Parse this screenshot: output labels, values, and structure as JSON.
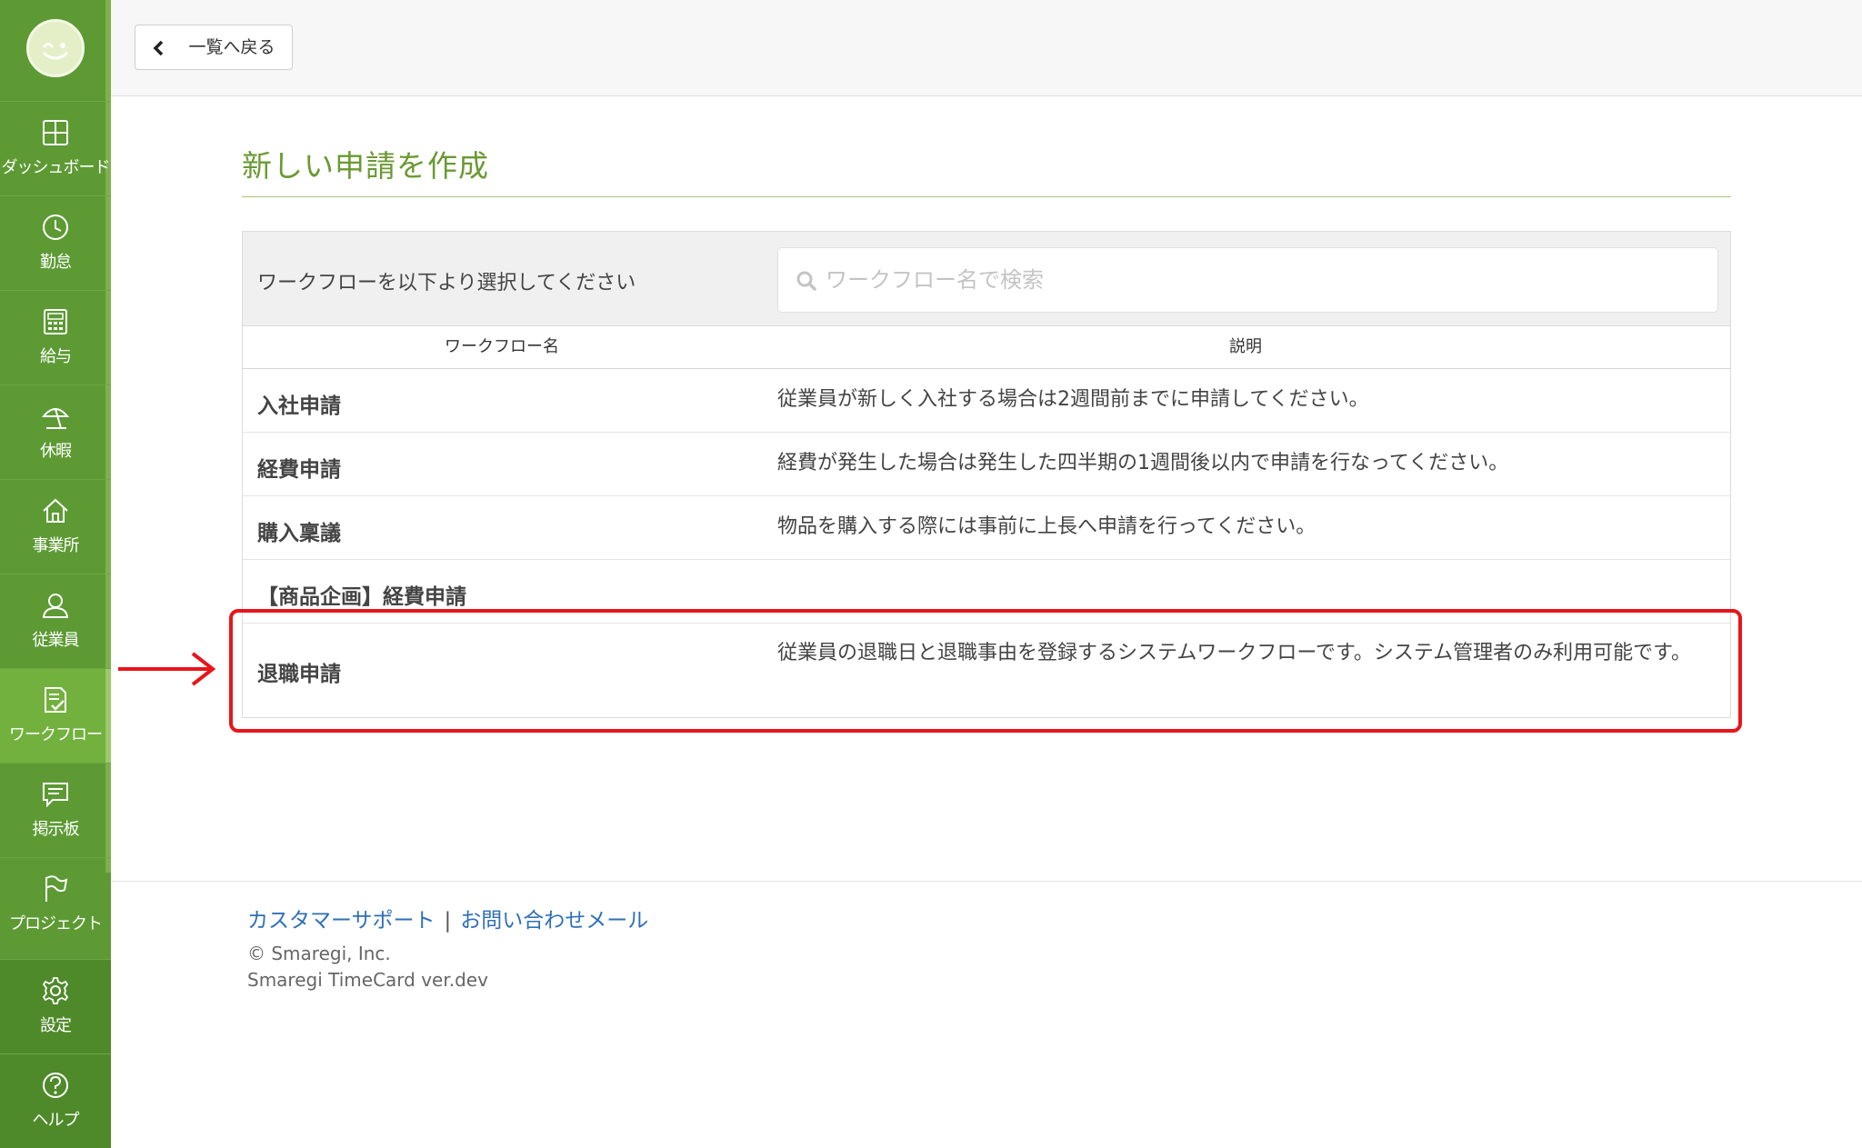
{
  "sidebar": {
    "items": [
      {
        "key": "dashboard",
        "label": "ダッシュボード",
        "icon": "dashboard-icon"
      },
      {
        "key": "attendance",
        "label": "勤怠",
        "icon": "clock-icon"
      },
      {
        "key": "payroll",
        "label": "給与",
        "icon": "calculator-icon"
      },
      {
        "key": "leave",
        "label": "休暇",
        "icon": "umbrella-icon"
      },
      {
        "key": "office",
        "label": "事業所",
        "icon": "home-icon"
      },
      {
        "key": "employees",
        "label": "従業員",
        "icon": "person-icon"
      },
      {
        "key": "workflow",
        "label": "ワークフロー",
        "icon": "checklist-icon",
        "active": true
      },
      {
        "key": "board",
        "label": "掲示板",
        "icon": "message-icon"
      },
      {
        "key": "project",
        "label": "プロジェクト",
        "icon": "flag-icon"
      },
      {
        "key": "settings",
        "label": "設定",
        "icon": "gear-icon"
      },
      {
        "key": "help",
        "label": "ヘルプ",
        "icon": "help-icon"
      }
    ]
  },
  "toolbar": {
    "back_label": "一覧へ戻る"
  },
  "page": {
    "title": "新しい申請を作成"
  },
  "panel": {
    "prompt": "ワークフローを以下より選択してください",
    "search_placeholder": "ワークフロー名で検索",
    "columns": {
      "name": "ワークフロー名",
      "description": "説明"
    },
    "rows": [
      {
        "name": "入社申請",
        "description": "従業員が新しく入社する場合は2週間前までに申請してください。"
      },
      {
        "name": "経費申請",
        "description": "経費が発生した場合は発生した四半期の1週間後以内で申請を行なってください。"
      },
      {
        "name": "購入稟議",
        "description": "物品を購入する際には事前に上長へ申請を行ってください。"
      },
      {
        "name": "【商品企画】経費申請",
        "description": ""
      },
      {
        "name": "退職申請",
        "description": "従業員の退職日と退職事由を登録するシステムワークフローです。システム管理者のみ利用可能です。"
      }
    ]
  },
  "footer": {
    "support_link": "カスタマーサポート",
    "separator": "|",
    "contact_link": "お問い合わせメール",
    "copyright": "© Smaregi, Inc.",
    "version": "Smaregi TimeCard ver.dev"
  },
  "colors": {
    "sidebar": "#5d9a34",
    "accent": "#6a9a33",
    "highlight": "#e8151b",
    "link": "#2f6fb8"
  }
}
